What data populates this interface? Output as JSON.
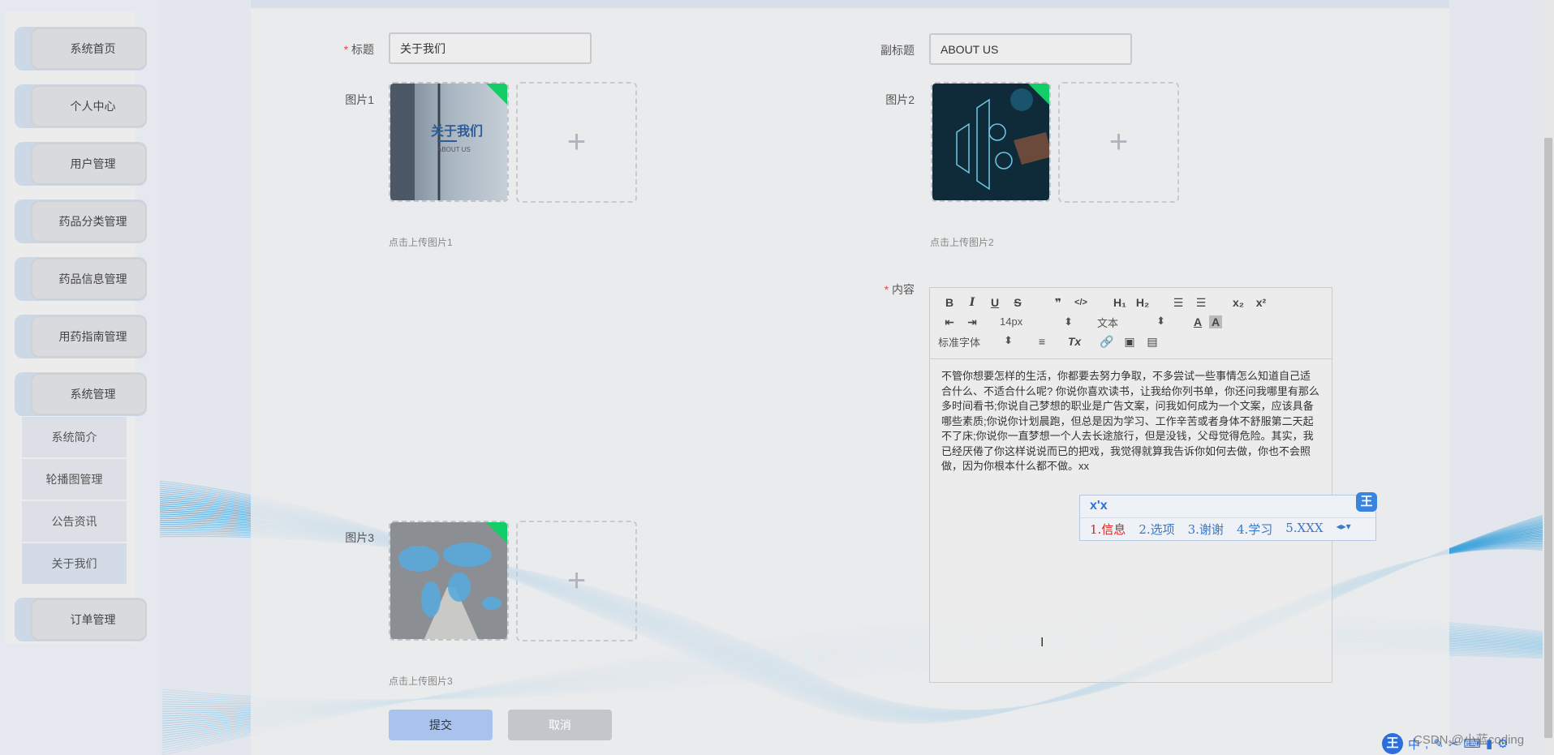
{
  "sidebar": {
    "items": [
      "系统首页",
      "个人中心",
      "用户管理",
      "药品分类管理",
      "药品信息管理",
      "用药指南管理",
      "系统管理"
    ],
    "submenu": [
      "系统简介",
      "轮播图管理",
      "公告资讯",
      "关于我们"
    ],
    "submenu_active": "关于我们",
    "last_item": "订单管理"
  },
  "form": {
    "title_label": "标题",
    "title_value": "关于我们",
    "subtitle_label": "副标题",
    "subtitle_value": "ABOUT US",
    "pic1_label": "图片1",
    "pic1_hint": "点击上传图片1",
    "pic2_label": "图片2",
    "pic2_hint": "点击上传图片2",
    "pic3_label": "图片3",
    "pic3_hint": "点击上传图片3",
    "content_label": "内容",
    "required_mark": "*",
    "submit": "提交",
    "cancel": "取消"
  },
  "editor": {
    "font_size": "14px",
    "header_select": "文本",
    "font_family": "标准字体",
    "buttons": {
      "bold": "B",
      "italic": "I",
      "underline": "U",
      "strike": "S",
      "quote": "❞",
      "code": "</>",
      "h1": "H₁",
      "h2": "H₂",
      "sub": "x₂",
      "sup": "x²",
      "clean": "Tx"
    },
    "content": "不管你想要怎样的生活，你都要去努力争取，不多尝试一些事情怎么知道自己适合什么、不适合什么呢? 你说你喜欢读书，让我给你列书单，你还问我哪里有那么多时间看书;你说自己梦想的职业是广告文案，问我如何成为一个文案，应该具备哪些素质;你说你计划晨跑，但总是因为学习、工作辛苦或者身体不舒服第二天起不了床;你说你一直梦想一个人去长途旅行，但是没钱，父母觉得危险。其实，我已经厌倦了你这样说说而已的把戏，我觉得就算我告诉你如何去做，你也不会照做，因为你根本什么都不做。xx"
  },
  "ime": {
    "composition": "x'x",
    "candidates": [
      "1.信息",
      "2.选项",
      "3.谢谢",
      "4.学习",
      "5.XXX"
    ],
    "logo": "王"
  },
  "taskbar": {
    "ime_logo": "王",
    "mode": "中",
    "watermark": "CSDN @小蓝coding"
  },
  "colors": {
    "accent": "#13ce66",
    "submit": "#a9c3ec",
    "cancel": "#c4c6cc",
    "ime_blue": "#2a6fdb"
  }
}
